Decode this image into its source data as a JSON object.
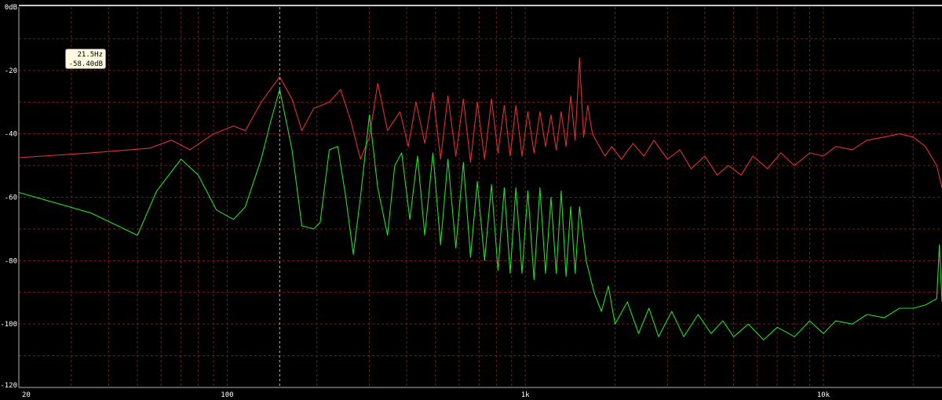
{
  "chart_data": {
    "type": "line",
    "xscale": "log",
    "xlim": [
      20,
      25000
    ],
    "ylim": [
      -120,
      0
    ],
    "grid": true,
    "x_tick_labels": [
      {
        "value": 20,
        "label": "20"
      },
      {
        "value": 100,
        "label": "100"
      },
      {
        "value": 1000,
        "label": "1k"
      },
      {
        "value": 10000,
        "label": "10k"
      }
    ],
    "y_tick_labels": [
      {
        "value": 0,
        "label": "0dB"
      },
      {
        "value": -20,
        "label": "-20"
      },
      {
        "value": -40,
        "label": "-40"
      },
      {
        "value": -60,
        "label": "-60"
      },
      {
        "value": -80,
        "label": "-80"
      },
      {
        "value": -100,
        "label": "-100"
      },
      {
        "value": -120,
        "label": "-120"
      }
    ],
    "cursor": {
      "freq": 21.5,
      "freq_label": "21.5Hz",
      "level_label": "-58.40dB"
    },
    "series": [
      {
        "color": "#e03030",
        "points": [
          [
            20,
            -47.5
          ],
          [
            35,
            -46
          ],
          [
            55,
            -44.5
          ],
          [
            65,
            -42
          ],
          [
            75,
            -45
          ],
          [
            90,
            -40
          ],
          [
            105,
            -37.5
          ],
          [
            115,
            -39
          ],
          [
            130,
            -30
          ],
          [
            150,
            -22
          ],
          [
            165,
            -29
          ],
          [
            178,
            -39
          ],
          [
            195,
            -32
          ],
          [
            220,
            -30
          ],
          [
            240,
            -26
          ],
          [
            260,
            -36
          ],
          [
            280,
            -48
          ],
          [
            300,
            -41
          ],
          [
            320,
            -24
          ],
          [
            345,
            -39
          ],
          [
            380,
            -33
          ],
          [
            405,
            -44
          ],
          [
            430,
            -30
          ],
          [
            460,
            -43
          ],
          [
            490,
            -27
          ],
          [
            520,
            -48
          ],
          [
            550,
            -28
          ],
          [
            585,
            -47
          ],
          [
            620,
            -29
          ],
          [
            655,
            -49
          ],
          [
            690,
            -30
          ],
          [
            730,
            -48
          ],
          [
            770,
            -29
          ],
          [
            810,
            -46
          ],
          [
            850,
            -31
          ],
          [
            890,
            -47
          ],
          [
            930,
            -31
          ],
          [
            975,
            -47
          ],
          [
            1020,
            -33
          ],
          [
            1070,
            -46
          ],
          [
            1120,
            -33
          ],
          [
            1170,
            -44
          ],
          [
            1220,
            -34
          ],
          [
            1270,
            -45
          ],
          [
            1320,
            -33
          ],
          [
            1370,
            -44
          ],
          [
            1420,
            -28
          ],
          [
            1470,
            -42
          ],
          [
            1520,
            -16
          ],
          [
            1570,
            -41
          ],
          [
            1620,
            -31
          ],
          [
            1680,
            -40
          ],
          [
            1750,
            -43
          ],
          [
            1850,
            -47
          ],
          [
            1950,
            -44
          ],
          [
            2100,
            -48
          ],
          [
            2300,
            -43
          ],
          [
            2500,
            -47
          ],
          [
            2700,
            -42
          ],
          [
            3000,
            -48
          ],
          [
            3300,
            -45
          ],
          [
            3600,
            -51
          ],
          [
            4000,
            -47
          ],
          [
            4400,
            -53
          ],
          [
            4800,
            -50
          ],
          [
            5300,
            -53
          ],
          [
            5800,
            -47
          ],
          [
            6500,
            -51
          ],
          [
            7200,
            -46
          ],
          [
            8000,
            -50
          ],
          [
            9000,
            -46
          ],
          [
            10000,
            -47
          ],
          [
            11000,
            -44
          ],
          [
            12500,
            -45
          ],
          [
            14000,
            -42
          ],
          [
            16000,
            -41
          ],
          [
            18000,
            -40
          ],
          [
            20000,
            -41
          ],
          [
            22000,
            -44
          ],
          [
            24000,
            -50
          ],
          [
            25000,
            -57
          ]
        ]
      },
      {
        "color": "#20e020",
        "points": [
          [
            20,
            -58.5
          ],
          [
            35,
            -65
          ],
          [
            50,
            -72
          ],
          [
            58,
            -58
          ],
          [
            70,
            -48
          ],
          [
            80,
            -53
          ],
          [
            92,
            -64
          ],
          [
            105,
            -67
          ],
          [
            115,
            -63
          ],
          [
            130,
            -48
          ],
          [
            140,
            -36
          ],
          [
            150,
            -26
          ],
          [
            165,
            -45
          ],
          [
            178,
            -69
          ],
          [
            195,
            -70
          ],
          [
            205,
            -68
          ],
          [
            220,
            -45
          ],
          [
            235,
            -44
          ],
          [
            250,
            -60
          ],
          [
            265,
            -78
          ],
          [
            280,
            -60
          ],
          [
            300,
            -34
          ],
          [
            320,
            -57
          ],
          [
            345,
            -72
          ],
          [
            365,
            -50
          ],
          [
            385,
            -46
          ],
          [
            410,
            -67
          ],
          [
            435,
            -47
          ],
          [
            460,
            -72
          ],
          [
            490,
            -46
          ],
          [
            520,
            -75
          ],
          [
            550,
            -48
          ],
          [
            585,
            -76
          ],
          [
            620,
            -49
          ],
          [
            655,
            -79
          ],
          [
            690,
            -55
          ],
          [
            730,
            -80
          ],
          [
            770,
            -56
          ],
          [
            810,
            -83
          ],
          [
            850,
            -57
          ],
          [
            890,
            -84
          ],
          [
            930,
            -57
          ],
          [
            975,
            -84
          ],
          [
            1020,
            -58
          ],
          [
            1070,
            -86
          ],
          [
            1120,
            -57
          ],
          [
            1170,
            -84
          ],
          [
            1220,
            -60
          ],
          [
            1270,
            -84
          ],
          [
            1320,
            -58
          ],
          [
            1370,
            -85
          ],
          [
            1420,
            -63
          ],
          [
            1470,
            -84
          ],
          [
            1520,
            -63
          ],
          [
            1600,
            -80
          ],
          [
            1700,
            -90
          ],
          [
            1800,
            -96
          ],
          [
            1900,
            -88
          ],
          [
            2000,
            -100
          ],
          [
            2200,
            -93
          ],
          [
            2400,
            -103
          ],
          [
            2600,
            -95
          ],
          [
            2800,
            -104
          ],
          [
            3100,
            -96
          ],
          [
            3400,
            -104
          ],
          [
            3800,
            -97
          ],
          [
            4200,
            -103
          ],
          [
            4600,
            -99
          ],
          [
            5000,
            -104
          ],
          [
            5600,
            -100
          ],
          [
            6300,
            -105
          ],
          [
            7000,
            -101
          ],
          [
            8000,
            -104
          ],
          [
            9000,
            -99
          ],
          [
            10000,
            -103
          ],
          [
            11000,
            -99
          ],
          [
            12500,
            -100
          ],
          [
            14000,
            -97
          ],
          [
            16000,
            -98
          ],
          [
            18000,
            -95
          ],
          [
            20000,
            -95
          ],
          [
            22000,
            -94
          ],
          [
            24000,
            -92
          ],
          [
            24500,
            -75
          ],
          [
            25000,
            -93
          ]
        ]
      }
    ]
  }
}
